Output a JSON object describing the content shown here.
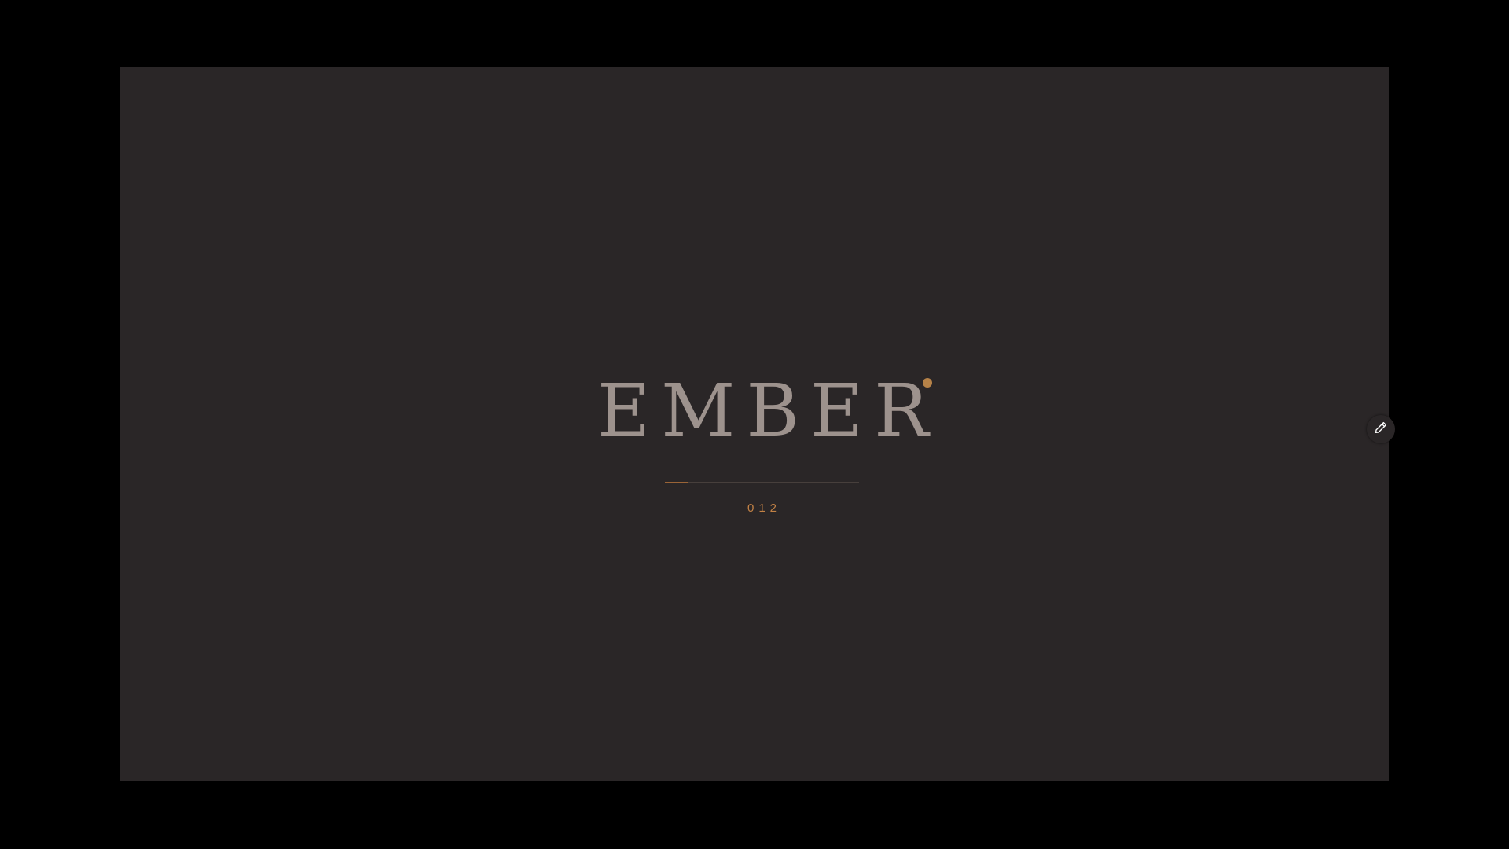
{
  "slide": {
    "brand_text": "EMBER",
    "counter_text": "012",
    "progress": 0.12
  },
  "controls": {
    "edit_icon": "pencil-icon"
  },
  "colors": {
    "outer_background": "#000000",
    "slide_background": "#2a2627",
    "brand_text": "#9d928d",
    "accent": "#b68248",
    "progress_track": "#473f3c",
    "progress_fill": "#9a6437",
    "counter_text": "#c28145"
  }
}
